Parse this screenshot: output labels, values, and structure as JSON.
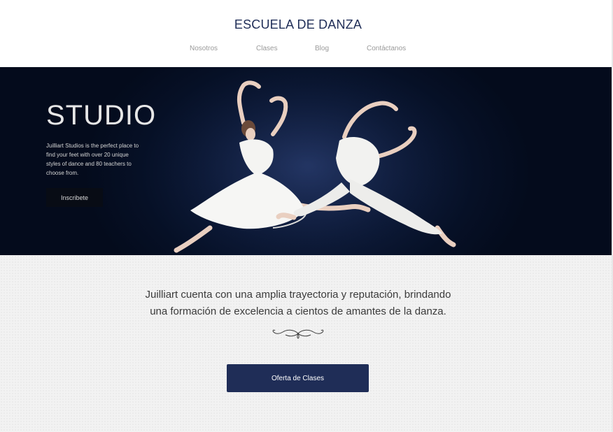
{
  "header": {
    "title": "ESCUELA DE DANZA",
    "nav": [
      "Nosotros",
      "Clases",
      "Blog",
      "Contáctanos"
    ]
  },
  "hero": {
    "title": "STUDIO",
    "description": "Juilliart Studios is the perfect place to find your feet with over 20 unique styles of dance and 80 teachers to choose from.",
    "button_label": "Inscribete"
  },
  "main": {
    "intro_line1": "Juilliart cuenta con una amplia trayectoria y reputación, brindando",
    "intro_line2": "una formación de excelencia a cientos de amantes de la danza.",
    "button_label": "Oferta de Clases"
  },
  "colors": {
    "brand_navy": "#1f2d57",
    "hero_dark": "#061026",
    "content_bg": "#f2f2f2"
  },
  "icons": {
    "ornament": "flourish-divider-icon",
    "hero_image": "dancers-image"
  }
}
